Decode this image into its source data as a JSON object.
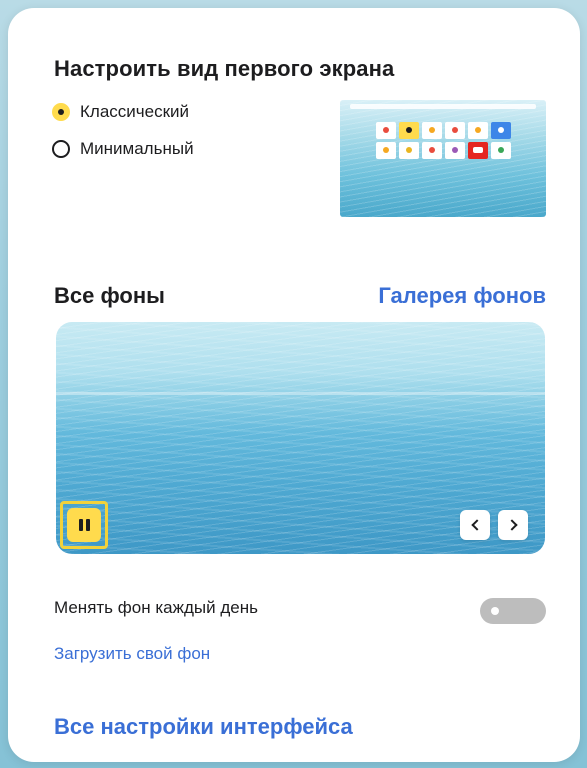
{
  "first_screen": {
    "title": "Настроить вид первого экрана",
    "options": [
      {
        "label": "Классический",
        "selected": true
      },
      {
        "label": "Минимальный",
        "selected": false
      }
    ],
    "preview_icon": "new-tab-preview-thumbnail"
  },
  "backgrounds": {
    "title": "Все фоны",
    "gallery_link": "Галерея фонов",
    "current_image": "sea-water-surface",
    "pause_icon": "pause-icon",
    "prev_icon": "chevron-left-icon",
    "next_icon": "chevron-right-icon"
  },
  "daily_change": {
    "label": "Менять фон каждый день",
    "enabled": false
  },
  "upload_link": "Загрузить свой фон",
  "all_settings_link": "Все настройки интерфейса",
  "colors": {
    "accent_yellow": "#ffdb4d",
    "link_blue": "#3a6fd6",
    "toggle_off": "#bdbdbd",
    "text": "#1d1d1f"
  }
}
